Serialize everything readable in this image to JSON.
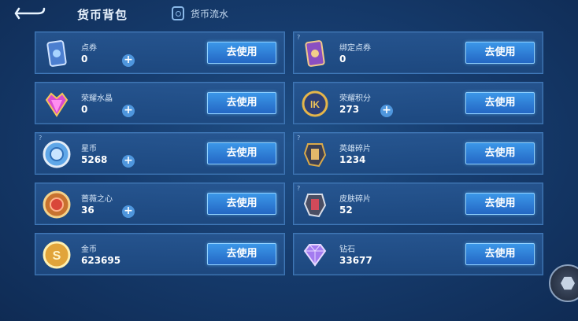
{
  "header": {
    "title": "货币背包",
    "flow_label": "货币流水"
  },
  "colors": {
    "accent": "#3b97e8",
    "card_bg": "#2a5894",
    "plus": "#4e96dd"
  },
  "currencies": [
    {
      "name": "点券",
      "amount": "0",
      "has_plus": true,
      "has_help": false,
      "icon": "ticket-card-icon",
      "button": "去使用"
    },
    {
      "name": "绑定点券",
      "amount": "0",
      "has_plus": false,
      "has_help": true,
      "icon": "bound-ticket-card-icon",
      "button": "去使用"
    },
    {
      "name": "荣耀水晶",
      "amount": "0",
      "has_plus": true,
      "has_help": false,
      "icon": "glory-crystal-icon",
      "button": "去使用"
    },
    {
      "name": "荣耀积分",
      "amount": "273",
      "has_plus": true,
      "has_help": false,
      "icon": "glory-points-icon",
      "button": "去使用"
    },
    {
      "name": "星币",
      "amount": "5268",
      "has_plus": true,
      "has_help": true,
      "icon": "star-coin-icon",
      "button": "去使用"
    },
    {
      "name": "英雄碎片",
      "amount": "1234",
      "has_plus": false,
      "has_help": true,
      "icon": "hero-fragment-icon",
      "button": "去使用"
    },
    {
      "name": "蔷薇之心",
      "amount": "36",
      "has_plus": true,
      "has_help": false,
      "icon": "rose-heart-icon",
      "button": "去使用"
    },
    {
      "name": "皮肤碎片",
      "amount": "52",
      "has_plus": false,
      "has_help": true,
      "icon": "skin-fragment-icon",
      "button": "去使用"
    },
    {
      "name": "金币",
      "amount": "623695",
      "has_plus": false,
      "has_help": false,
      "icon": "gold-coin-icon",
      "button": "去使用"
    },
    {
      "name": "钻石",
      "amount": "33677",
      "has_plus": false,
      "has_help": false,
      "icon": "diamond-icon",
      "button": "去使用"
    }
  ]
}
